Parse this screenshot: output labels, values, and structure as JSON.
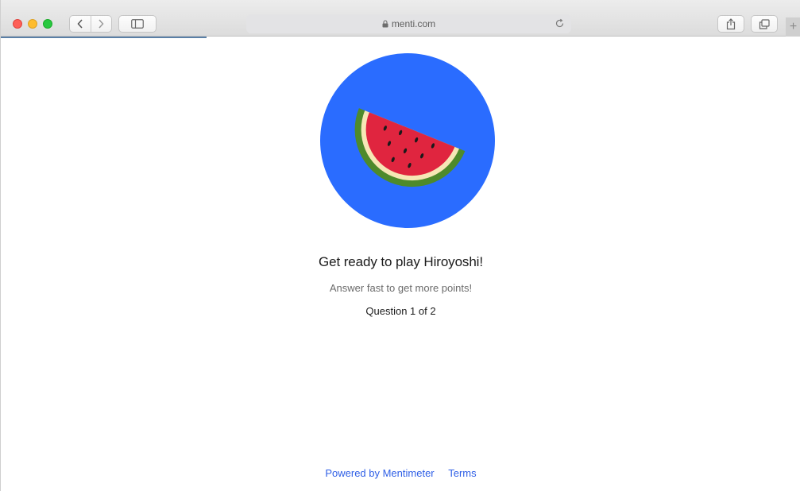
{
  "browser": {
    "url": "menti.com"
  },
  "quiz": {
    "title": "Get ready to play Hiroyoshi!",
    "subtitle": "Answer fast to get more points!",
    "question_count": "Question 1 of 2",
    "avatar": "watermelon-icon"
  },
  "footer": {
    "powered_by": "Powered by Mentimeter",
    "terms": "Terms"
  },
  "colors": {
    "avatar_background": "#2a6cff",
    "link": "#2f5fe6"
  }
}
